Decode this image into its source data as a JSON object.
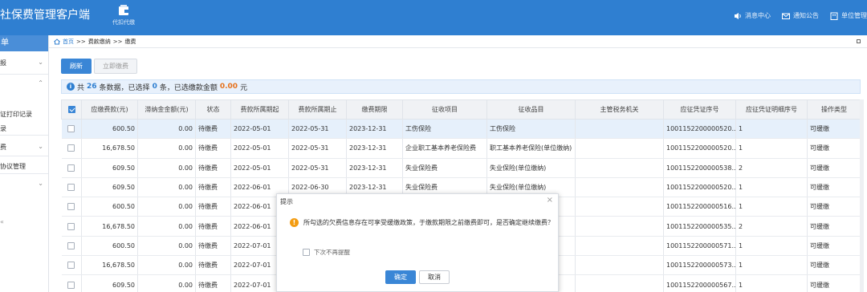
{
  "app": {
    "title": "社保费管理客户端"
  },
  "topnav": {
    "module_label": "代扣代缴",
    "items": [
      {
        "label": "消息中心",
        "icon": "speaker-icon"
      },
      {
        "label": "通知公告",
        "icon": "mail-icon"
      },
      {
        "label": "单位管理",
        "icon": "building-icon"
      }
    ]
  },
  "sidebar": {
    "header": "单",
    "items": [
      {
        "label": "报"
      },
      {
        "label": ""
      },
      {
        "label": "证打印记录"
      },
      {
        "label": "录"
      },
      {
        "label": "费"
      },
      {
        "label": "协议管理"
      }
    ],
    "collapse": "«"
  },
  "breadcrumb": {
    "home": "首页",
    "sep1": ">>",
    "p2": "费款缴纳",
    "sep2": ">>",
    "p3": "缴费"
  },
  "toolbar": {
    "refresh": "刷新",
    "pay": "立即缴费"
  },
  "summary": {
    "prefix": "共",
    "total": "26",
    "mid1": "条数据，已选择",
    "selected": "0",
    "mid2": "条，已选缴款金额",
    "amount": "0.00",
    "suffix": "元"
  },
  "table": {
    "columns": [
      "应缴费款(元)",
      "滞纳金金额(元)",
      "状态",
      "费款所属期起",
      "费款所属期止",
      "缴费期限",
      "征收项目",
      "征收品目",
      "主管税务机关",
      "应征凭证序号",
      "应征凭证明细序号",
      "操作类型"
    ],
    "rows": [
      [
        "600.50",
        "0.00",
        "待缴费",
        "2022-05-01",
        "2022-05-31",
        "2023-12-31",
        "工伤保险",
        "工伤保险",
        "",
        "1001152200000520...",
        "1",
        "可缓缴"
      ],
      [
        "16,678.50",
        "0.00",
        "待缴费",
        "2022-05-01",
        "2022-05-31",
        "2023-12-31",
        "企业职工基本养老保险费",
        "职工基本养老保险(单位缴纳)",
        "",
        "1001152200000520...",
        "1",
        "可缓缴"
      ],
      [
        "609.50",
        "0.00",
        "待缴费",
        "2022-05-01",
        "2022-05-31",
        "2023-12-31",
        "失业保险费",
        "失业保险(单位缴纳)",
        "",
        "1001152200000538...",
        "2",
        "可缓缴"
      ],
      [
        "609.50",
        "0.00",
        "待缴费",
        "2022-06-01",
        "2022-06-30",
        "2023-12-31",
        "失业保险费",
        "失业保险(单位缴纳)",
        "",
        "1001152200000520...",
        "1",
        "可缓缴"
      ],
      [
        "600.50",
        "0.00",
        "待缴费",
        "2022-06-01",
        "",
        "",
        "",
        "",
        "",
        "1001152200000516...",
        "1",
        "可缓缴"
      ],
      [
        "16,678.50",
        "0.00",
        "待缴费",
        "2022-06-01",
        "",
        "",
        "",
        "内)",
        "",
        "1001152200000535...",
        "2",
        "可缓缴"
      ],
      [
        "600.50",
        "0.00",
        "待缴费",
        "2022-07-01",
        "",
        "",
        "",
        "",
        "",
        "1001152200000571...",
        "1",
        "可缓缴"
      ],
      [
        "16,678.50",
        "0.00",
        "待缴费",
        "2022-07-01",
        "",
        "",
        "",
        "内)",
        "",
        "1001152200000573...",
        "1",
        "可缓缴"
      ],
      [
        "609.50",
        "0.00",
        "待缴费",
        "2022-07-01",
        "",
        "",
        "",
        "",
        "",
        "1001152200000567...",
        "1",
        "可缓缴"
      ]
    ]
  },
  "dialog": {
    "title": "提示",
    "close": "×",
    "message": "所勾选的欠费信息存在可享受缓缴政策，于缴款期限之前缴费即可，是否确定继续缴费？",
    "checkbox_label": "下次不再提醒",
    "ok": "确定",
    "cancel": "取消"
  },
  "colors": {
    "brand": "#2f7fd1",
    "warning": "#f39c12",
    "amount": "#e6711c"
  }
}
